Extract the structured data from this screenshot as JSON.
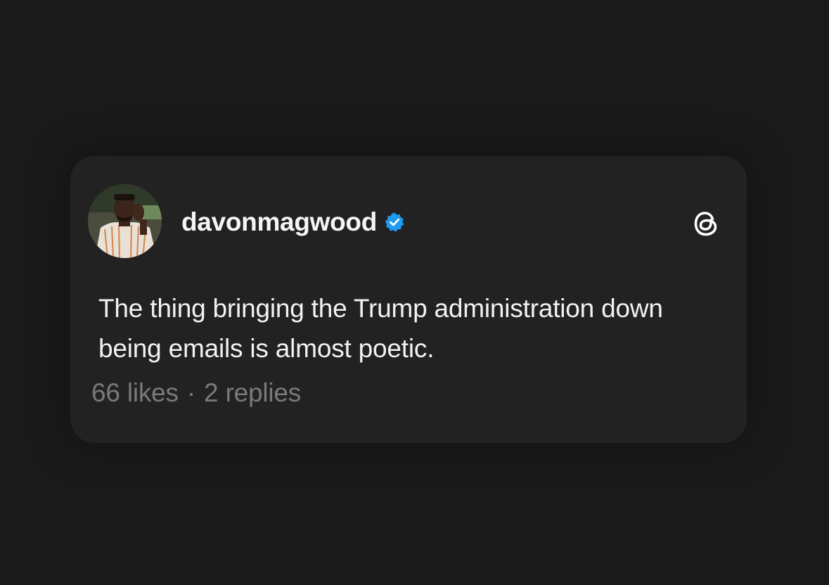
{
  "post": {
    "username": "davonmagwood",
    "verified": true,
    "text": "The thing bringing the Trump administration down being emails is almost poetic.",
    "likes": "66 likes",
    "separator": "·",
    "replies": "2 replies"
  },
  "icons": {
    "verified": "verified-badge-icon",
    "brand": "threads-logo-icon",
    "avatar": "profile-avatar"
  },
  "colors": {
    "background": "#1a1a1a",
    "card": "#222222",
    "verified_blue": "#1d9bf0",
    "text_primary": "#f2f2f2",
    "text_secondary": "#7a7a7a"
  }
}
